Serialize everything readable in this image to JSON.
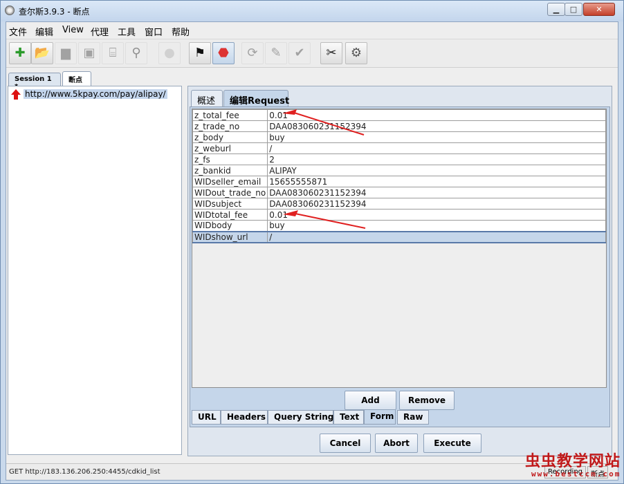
{
  "window": {
    "title": "查尔斯3.9.3 - 断点"
  },
  "menu": [
    "文件",
    "编辑",
    "View",
    "代理",
    "工具",
    "窗口",
    "帮助"
  ],
  "toolbar": [
    {
      "icon": "new-session-icon",
      "glyph": "✚",
      "color": "#2a9a2a",
      "state": "enabled"
    },
    {
      "icon": "open-session-icon",
      "glyph": "📂",
      "color": "#3a7fc0",
      "state": "enabled"
    },
    {
      "icon": "close-session-icon",
      "glyph": "▆",
      "color": "#666",
      "state": "disabled"
    },
    {
      "icon": "save-icon",
      "glyph": "▣",
      "color": "#666",
      "state": "disabled"
    },
    {
      "icon": "clear-icon",
      "glyph": "⌸",
      "color": "#666",
      "state": "disabled"
    },
    {
      "icon": "find-icon",
      "glyph": "⚲",
      "color": "#444",
      "state": "disabled"
    },
    {
      "icon": "record-icon",
      "glyph": "●",
      "color": "#bbb",
      "state": "disabled"
    },
    {
      "icon": "throttle-icon",
      "glyph": "⚑",
      "color": "#111",
      "state": "enabled"
    },
    {
      "icon": "breakpoint-stop-icon",
      "glyph": "⬣",
      "color": "#d33",
      "state": "active"
    },
    {
      "icon": "repeat-icon",
      "glyph": "⟳",
      "color": "#666",
      "state": "disabled"
    },
    {
      "icon": "edit-icon",
      "glyph": "✎",
      "color": "#666",
      "state": "disabled"
    },
    {
      "icon": "validate-icon",
      "glyph": "✔",
      "color": "#666",
      "state": "disabled"
    },
    {
      "icon": "tools-icon",
      "glyph": "✂",
      "color": "#222",
      "state": "enabled"
    },
    {
      "icon": "settings-icon",
      "glyph": "⚙",
      "color": "#555",
      "state": "enabled"
    }
  ],
  "session_tabs": [
    "Session 1 *",
    "断点"
  ],
  "tree": {
    "url": "http://www.5kpay.com/pay/alipay/"
  },
  "request_tabs": [
    "概述",
    "编辑Request"
  ],
  "form_fields": [
    {
      "key": "z_total_fee",
      "value": "0.01"
    },
    {
      "key": "z_trade_no",
      "value": "DAA083060231152394"
    },
    {
      "key": "z_body",
      "value": "buy"
    },
    {
      "key": "z_weburl",
      "value": "/"
    },
    {
      "key": "z_fs",
      "value": "2"
    },
    {
      "key": "z_bankid",
      "value": "ALIPAY"
    },
    {
      "key": "WIDseller_email",
      "value": "15655555871"
    },
    {
      "key": "WIDout_trade_no",
      "value": "DAA083060231152394"
    },
    {
      "key": "WIDsubject",
      "value": "DAA083060231152394"
    },
    {
      "key": "WIDtotal_fee",
      "value": "0.01"
    },
    {
      "key": "WIDbody",
      "value": "buy"
    },
    {
      "key": "WIDshow_url",
      "value": "/"
    }
  ],
  "form_buttons": {
    "add": "Add",
    "remove": "Remove"
  },
  "view_tabs": [
    "URL",
    "Headers",
    "Query String",
    "Text",
    "Form",
    "Raw"
  ],
  "action_buttons": {
    "cancel": "Cancel",
    "abort": "Abort",
    "execute": "Execute"
  },
  "status": {
    "text": "GET http://183.136.206.250:4455/cdkid_list",
    "recording": "Recording",
    "breakpoints": "断点"
  },
  "watermark": {
    "title": "虫虫教学网站",
    "url": "www.bestccm.com"
  },
  "colors": {
    "accent": "#c5d6ea",
    "annotation_arrow": "#e02020"
  }
}
